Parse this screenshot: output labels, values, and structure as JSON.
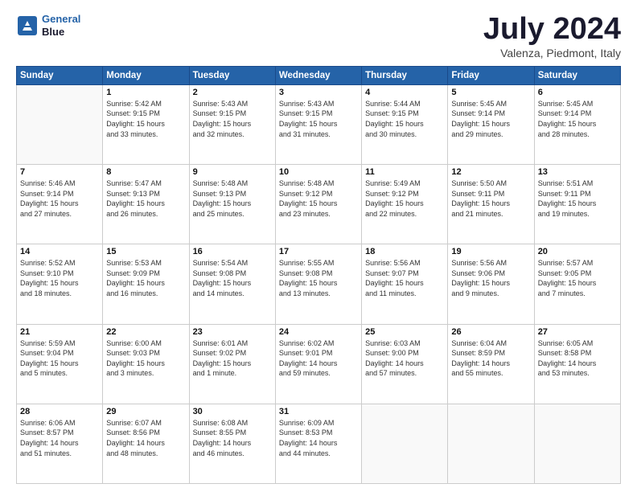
{
  "header": {
    "logo_line1": "General",
    "logo_line2": "Blue",
    "title": "July 2024",
    "location": "Valenza, Piedmont, Italy"
  },
  "weekdays": [
    "Sunday",
    "Monday",
    "Tuesday",
    "Wednesday",
    "Thursday",
    "Friday",
    "Saturday"
  ],
  "weeks": [
    [
      {
        "day": "",
        "info": ""
      },
      {
        "day": "1",
        "info": "Sunrise: 5:42 AM\nSunset: 9:15 PM\nDaylight: 15 hours\nand 33 minutes."
      },
      {
        "day": "2",
        "info": "Sunrise: 5:43 AM\nSunset: 9:15 PM\nDaylight: 15 hours\nand 32 minutes."
      },
      {
        "day": "3",
        "info": "Sunrise: 5:43 AM\nSunset: 9:15 PM\nDaylight: 15 hours\nand 31 minutes."
      },
      {
        "day": "4",
        "info": "Sunrise: 5:44 AM\nSunset: 9:15 PM\nDaylight: 15 hours\nand 30 minutes."
      },
      {
        "day": "5",
        "info": "Sunrise: 5:45 AM\nSunset: 9:14 PM\nDaylight: 15 hours\nand 29 minutes."
      },
      {
        "day": "6",
        "info": "Sunrise: 5:45 AM\nSunset: 9:14 PM\nDaylight: 15 hours\nand 28 minutes."
      }
    ],
    [
      {
        "day": "7",
        "info": "Sunrise: 5:46 AM\nSunset: 9:14 PM\nDaylight: 15 hours\nand 27 minutes."
      },
      {
        "day": "8",
        "info": "Sunrise: 5:47 AM\nSunset: 9:13 PM\nDaylight: 15 hours\nand 26 minutes."
      },
      {
        "day": "9",
        "info": "Sunrise: 5:48 AM\nSunset: 9:13 PM\nDaylight: 15 hours\nand 25 minutes."
      },
      {
        "day": "10",
        "info": "Sunrise: 5:48 AM\nSunset: 9:12 PM\nDaylight: 15 hours\nand 23 minutes."
      },
      {
        "day": "11",
        "info": "Sunrise: 5:49 AM\nSunset: 9:12 PM\nDaylight: 15 hours\nand 22 minutes."
      },
      {
        "day": "12",
        "info": "Sunrise: 5:50 AM\nSunset: 9:11 PM\nDaylight: 15 hours\nand 21 minutes."
      },
      {
        "day": "13",
        "info": "Sunrise: 5:51 AM\nSunset: 9:11 PM\nDaylight: 15 hours\nand 19 minutes."
      }
    ],
    [
      {
        "day": "14",
        "info": "Sunrise: 5:52 AM\nSunset: 9:10 PM\nDaylight: 15 hours\nand 18 minutes."
      },
      {
        "day": "15",
        "info": "Sunrise: 5:53 AM\nSunset: 9:09 PM\nDaylight: 15 hours\nand 16 minutes."
      },
      {
        "day": "16",
        "info": "Sunrise: 5:54 AM\nSunset: 9:08 PM\nDaylight: 15 hours\nand 14 minutes."
      },
      {
        "day": "17",
        "info": "Sunrise: 5:55 AM\nSunset: 9:08 PM\nDaylight: 15 hours\nand 13 minutes."
      },
      {
        "day": "18",
        "info": "Sunrise: 5:56 AM\nSunset: 9:07 PM\nDaylight: 15 hours\nand 11 minutes."
      },
      {
        "day": "19",
        "info": "Sunrise: 5:56 AM\nSunset: 9:06 PM\nDaylight: 15 hours\nand 9 minutes."
      },
      {
        "day": "20",
        "info": "Sunrise: 5:57 AM\nSunset: 9:05 PM\nDaylight: 15 hours\nand 7 minutes."
      }
    ],
    [
      {
        "day": "21",
        "info": "Sunrise: 5:59 AM\nSunset: 9:04 PM\nDaylight: 15 hours\nand 5 minutes."
      },
      {
        "day": "22",
        "info": "Sunrise: 6:00 AM\nSunset: 9:03 PM\nDaylight: 15 hours\nand 3 minutes."
      },
      {
        "day": "23",
        "info": "Sunrise: 6:01 AM\nSunset: 9:02 PM\nDaylight: 15 hours\nand 1 minute."
      },
      {
        "day": "24",
        "info": "Sunrise: 6:02 AM\nSunset: 9:01 PM\nDaylight: 14 hours\nand 59 minutes."
      },
      {
        "day": "25",
        "info": "Sunrise: 6:03 AM\nSunset: 9:00 PM\nDaylight: 14 hours\nand 57 minutes."
      },
      {
        "day": "26",
        "info": "Sunrise: 6:04 AM\nSunset: 8:59 PM\nDaylight: 14 hours\nand 55 minutes."
      },
      {
        "day": "27",
        "info": "Sunrise: 6:05 AM\nSunset: 8:58 PM\nDaylight: 14 hours\nand 53 minutes."
      }
    ],
    [
      {
        "day": "28",
        "info": "Sunrise: 6:06 AM\nSunset: 8:57 PM\nDaylight: 14 hours\nand 51 minutes."
      },
      {
        "day": "29",
        "info": "Sunrise: 6:07 AM\nSunset: 8:56 PM\nDaylight: 14 hours\nand 48 minutes."
      },
      {
        "day": "30",
        "info": "Sunrise: 6:08 AM\nSunset: 8:55 PM\nDaylight: 14 hours\nand 46 minutes."
      },
      {
        "day": "31",
        "info": "Sunrise: 6:09 AM\nSunset: 8:53 PM\nDaylight: 14 hours\nand 44 minutes."
      },
      {
        "day": "",
        "info": ""
      },
      {
        "day": "",
        "info": ""
      },
      {
        "day": "",
        "info": ""
      }
    ]
  ]
}
